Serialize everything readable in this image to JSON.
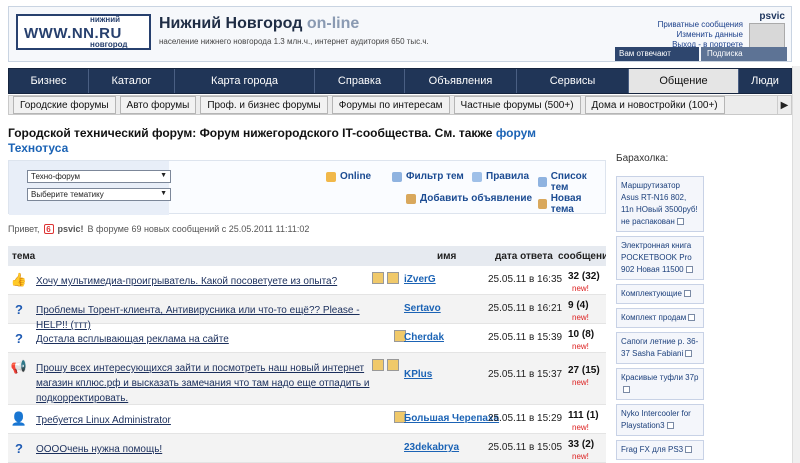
{
  "header": {
    "logo": {
      "top": "нижний",
      "main": "WWW.NN.RU",
      "bottom": "новгород"
    },
    "site_title": "Нижний Новгород",
    "site_title_suffix": "on-line",
    "site_subtitle": "население нижнего новгорода 1.3 млн.ч., интернет аудитория 650 тыс.ч.",
    "user": {
      "name": "psvic",
      "links": [
        "Приватные сообщения",
        "Изменить данные",
        "Выход - в портрете"
      ],
      "reply_label": "Вам отвечают",
      "subscribe_label": "Подписка"
    }
  },
  "main_nav": {
    "tabs": [
      {
        "label": "Бизнес"
      },
      {
        "label": "Каталог"
      },
      {
        "label": "Карта города"
      },
      {
        "label": "Справка"
      },
      {
        "label": "Объявления"
      },
      {
        "label": "Сервисы"
      },
      {
        "label": "Общение"
      },
      {
        "label": "Люди"
      }
    ],
    "active": "Общение"
  },
  "sub_nav": {
    "items": [
      {
        "label": "Городские форумы"
      },
      {
        "label": "Авто форумы"
      },
      {
        "label": "Проф. и бизнес форумы"
      },
      {
        "label": "Форумы по интересам"
      },
      {
        "label": "Частные форумы (500+)"
      },
      {
        "label": "Дома и новостройки (100+)"
      }
    ]
  },
  "forum": {
    "title_prefix": "Городской технический форум: Форум нижегородского IT-сообщества. См. также",
    "title_link_part1": "форум",
    "title_link_part2": "Технотуса"
  },
  "filter": {
    "select1": "Техно-форум",
    "select2": "Выберите тематику",
    "links": [
      "Online",
      "Фильтр тем",
      "Правила",
      "Список тем",
      "Добавить объявление",
      "Новая тема"
    ]
  },
  "greeting": {
    "prefix": "Привет,",
    "badge": "6",
    "user": "psvic!",
    "text": "В форуме 69 новых сообщений с 25.05.2011 11:11:02"
  },
  "table": {
    "headers": {
      "topic": "тема",
      "name": "имя",
      "date": "дата ответа",
      "msgs": "сообщений"
    },
    "rows": [
      {
        "icon": "👍",
        "topic": "Хочу мультимедиа-проигрыватель. Какой посоветуете из опыта?",
        "author": "iZverG",
        "date": "25.05.11 в 16:35",
        "msgs": "32 (32)",
        "new": "new!"
      },
      {
        "icon": "?",
        "topic": "Проблемы Торент-клиента, Антивирусника или что-то ещё?? Please -HELP!! (ттт)",
        "author": "Sertavo",
        "date": "25.05.11 в 16:21",
        "msgs": "9 (4)",
        "new": "new!"
      },
      {
        "icon": "?",
        "topic": "Достала всплывающая реклама на сайте",
        "author": "Cherdak",
        "date": "25.05.11 в 15:39",
        "msgs": "10 (8)",
        "new": "new!"
      },
      {
        "icon": "📢",
        "topic": "Прошу всех интересующихся зайти и посмотреть наш новый интернет магазин кплюс.рф и высказать замечания что там надо еще отпадить и подкорректировать.",
        "author": "KPlus",
        "date": "25.05.11 в 15:37",
        "msgs": "27 (15)",
        "new": "new!"
      },
      {
        "icon": "👤",
        "topic": "Требуется Linux Administrator",
        "author": "Большая Черепаха",
        "date": "25.05.11 в 15:29",
        "msgs": "111 (1)",
        "new": "new!"
      },
      {
        "icon": "?",
        "topic": "ООООчень нужна помощь!",
        "author": "23dekabrya",
        "date": "25.05.11 в 15:05",
        "msgs": "33 (2)",
        "new": "new!"
      }
    ]
  },
  "market": {
    "title": "Барахолка:",
    "items": [
      "Маршрутизатор Asus RT-N16 802, 11n НОвый 3500руб! не распакован",
      "Электронная книга POCKETBOOK Pro 902 Новая 11500",
      "Комплектующие",
      "Комплект продам",
      "Сапоги летние р. 36-37 Sasha Fabiani",
      "Красивые туфли 37р",
      "Nyko Intercooler for Playstation3",
      "Frag FX для PS3"
    ]
  },
  "colors": {
    "nav_bg": "#203557",
    "accent_link": "#1b63b5",
    "new_red": "#d22"
  }
}
